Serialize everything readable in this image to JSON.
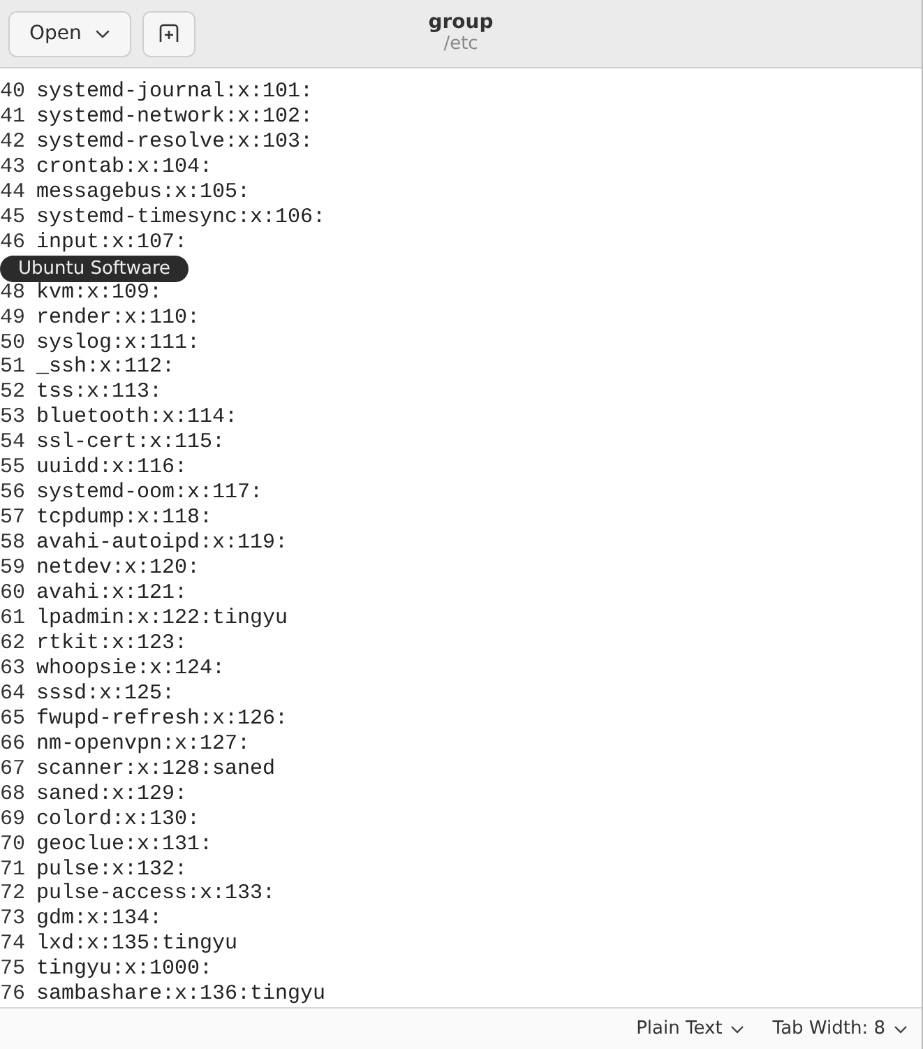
{
  "header": {
    "open_button": "Open",
    "title": "group",
    "subtitle": "/etc"
  },
  "lines": [
    {
      "kind": "text",
      "number": "40",
      "text": "systemd-journal:x:101:"
    },
    {
      "kind": "text",
      "number": "41",
      "text": "systemd-network:x:102:"
    },
    {
      "kind": "text",
      "number": "42",
      "text": "systemd-resolve:x:103:"
    },
    {
      "kind": "text",
      "number": "43",
      "text": "crontab:x:104:"
    },
    {
      "kind": "text",
      "number": "44",
      "text": "messagebus:x:105:"
    },
    {
      "kind": "text",
      "number": "45",
      "text": "systemd-timesync:x:106:"
    },
    {
      "kind": "text",
      "number": "46",
      "text": "input:x:107:"
    },
    {
      "kind": "covered"
    },
    {
      "kind": "text",
      "number": "48",
      "text": "kvm:x:109:"
    },
    {
      "kind": "text",
      "number": "49",
      "text": "render:x:110:"
    },
    {
      "kind": "text",
      "number": "50",
      "text": "syslog:x:111:"
    },
    {
      "kind": "text",
      "number": "51",
      "text": "_ssh:x:112:"
    },
    {
      "kind": "text",
      "number": "52",
      "text": "tss:x:113:"
    },
    {
      "kind": "text",
      "number": "53",
      "text": "bluetooth:x:114:"
    },
    {
      "kind": "text",
      "number": "54",
      "text": "ssl-cert:x:115:"
    },
    {
      "kind": "text",
      "number": "55",
      "text": "uuidd:x:116:"
    },
    {
      "kind": "text",
      "number": "56",
      "text": "systemd-oom:x:117:"
    },
    {
      "kind": "text",
      "number": "57",
      "text": "tcpdump:x:118:"
    },
    {
      "kind": "text",
      "number": "58",
      "text": "avahi-autoipd:x:119:"
    },
    {
      "kind": "text",
      "number": "59",
      "text": "netdev:x:120:"
    },
    {
      "kind": "text",
      "number": "60",
      "text": "avahi:x:121:"
    },
    {
      "kind": "text",
      "number": "61",
      "text": "lpadmin:x:122:tingyu"
    },
    {
      "kind": "text",
      "number": "62",
      "text": "rtkit:x:123:"
    },
    {
      "kind": "text",
      "number": "63",
      "text": "whoopsie:x:124:"
    },
    {
      "kind": "text",
      "number": "64",
      "text": "sssd:x:125:"
    },
    {
      "kind": "text",
      "number": "65",
      "text": "fwupd-refresh:x:126:"
    },
    {
      "kind": "text",
      "number": "66",
      "text": "nm-openvpn:x:127:"
    },
    {
      "kind": "text",
      "number": "67",
      "text": "scanner:x:128:saned"
    },
    {
      "kind": "text",
      "number": "68",
      "text": "saned:x:129:"
    },
    {
      "kind": "text",
      "number": "69",
      "text": "colord:x:130:"
    },
    {
      "kind": "text",
      "number": "70",
      "text": "geoclue:x:131:"
    },
    {
      "kind": "text",
      "number": "71",
      "text": "pulse:x:132:"
    },
    {
      "kind": "text",
      "number": "72",
      "text": "pulse-access:x:133:"
    },
    {
      "kind": "text",
      "number": "73",
      "text": "gdm:x:134:"
    },
    {
      "kind": "text",
      "number": "74",
      "text": "lxd:x:135:tingyu"
    },
    {
      "kind": "text",
      "number": "75",
      "text": "tingyu:x:1000:"
    },
    {
      "kind": "text",
      "number": "76",
      "text": "sambashare:x:136:tingyu"
    }
  ],
  "tooltip": "Ubuntu Software",
  "status_bar": {
    "language": "Plain Text",
    "tab_width": "Tab Width: 8"
  }
}
